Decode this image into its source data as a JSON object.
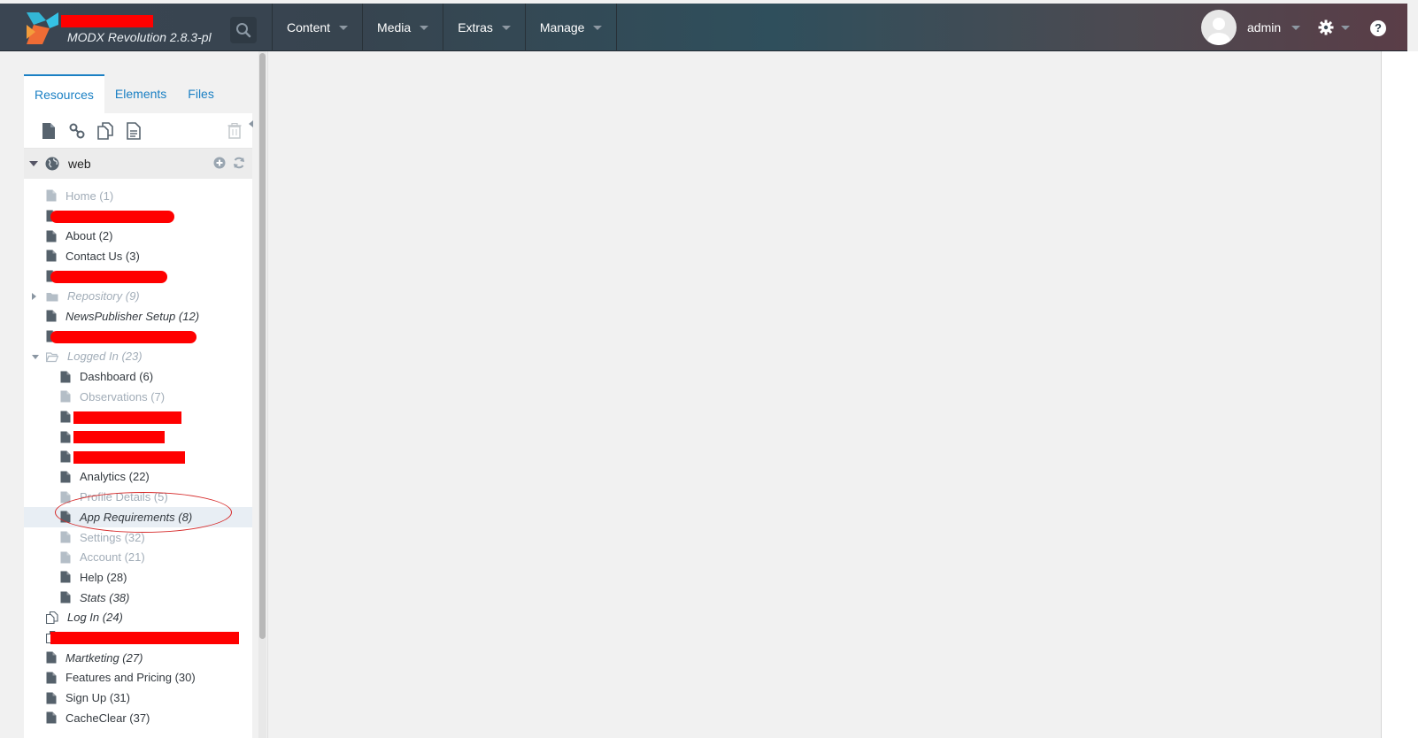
{
  "header": {
    "version_label": "MODX Revolution 2.8.3-pl",
    "nav": [
      "Content",
      "Media",
      "Extras",
      "Manage"
    ],
    "username": "admin"
  },
  "tabs": [
    "Resources",
    "Elements",
    "Files"
  ],
  "root": {
    "label": "web"
  },
  "tree": [
    {
      "label": "Home (1)",
      "level": 0,
      "faded": true,
      "italic": false,
      "icon": "document"
    },
    {
      "label": "",
      "level": 0,
      "redacted": true,
      "icon": "document"
    },
    {
      "label": "About (2)",
      "level": 0,
      "icon": "document"
    },
    {
      "label": "Contact Us (3)",
      "level": 0,
      "icon": "document"
    },
    {
      "label": "",
      "level": 0,
      "redacted": true,
      "icon": "document"
    },
    {
      "label": "Repository (9)",
      "level": 0,
      "faded": true,
      "italic": true,
      "icon": "folder",
      "expander": "collapsed"
    },
    {
      "label": "NewsPublisher Setup (12)",
      "level": 0,
      "italic": true,
      "icon": "document"
    },
    {
      "label": "",
      "level": 0,
      "redacted": true,
      "icon": "document"
    },
    {
      "label": "Logged In (23)",
      "level": 0,
      "faded": true,
      "italic": true,
      "icon": "folder-open",
      "expander": "expanded"
    },
    {
      "label": "Dashboard (6)",
      "level": 1,
      "icon": "document"
    },
    {
      "label": "Observations (7)",
      "level": 1,
      "faded": true,
      "icon": "document"
    },
    {
      "label": "",
      "level": 1,
      "redacted": true,
      "icon": "document"
    },
    {
      "label": "",
      "level": 1,
      "redacted": true,
      "icon": "document"
    },
    {
      "label": "",
      "level": 1,
      "redacted": true,
      "icon": "document"
    },
    {
      "label": "Analytics (22)",
      "level": 1,
      "icon": "document"
    },
    {
      "label": "Profile Details (5)",
      "level": 1,
      "faded": true,
      "icon": "document"
    },
    {
      "label": "App Requirements (8)",
      "level": 1,
      "italic": true,
      "selected": true,
      "icon": "document"
    },
    {
      "label": "Settings (32)",
      "level": 1,
      "faded": true,
      "icon": "document"
    },
    {
      "label": "Account (21)",
      "level": 1,
      "faded": true,
      "icon": "document"
    },
    {
      "label": "Help (28)",
      "level": 1,
      "icon": "document"
    },
    {
      "label": "Stats (38)",
      "level": 1,
      "italic": true,
      "icon": "document"
    },
    {
      "label": "Log In (24)",
      "level": 0,
      "italic": true,
      "icon": "symlink"
    },
    {
      "label": "",
      "level": 0,
      "redacted": true,
      "icon": "symlink"
    },
    {
      "label": "Martketing (27)",
      "level": 0,
      "italic": true,
      "icon": "document"
    },
    {
      "label": "Features and Pricing (30)",
      "level": 0,
      "icon": "document"
    },
    {
      "label": "Sign Up (31)",
      "level": 0,
      "icon": "document"
    },
    {
      "label": "CacheClear (37)",
      "level": 0,
      "icon": "document"
    }
  ],
  "colors": {
    "accent": "#1b80c4",
    "redaction": "#ff0000",
    "annotation": "#d62a2a"
  }
}
